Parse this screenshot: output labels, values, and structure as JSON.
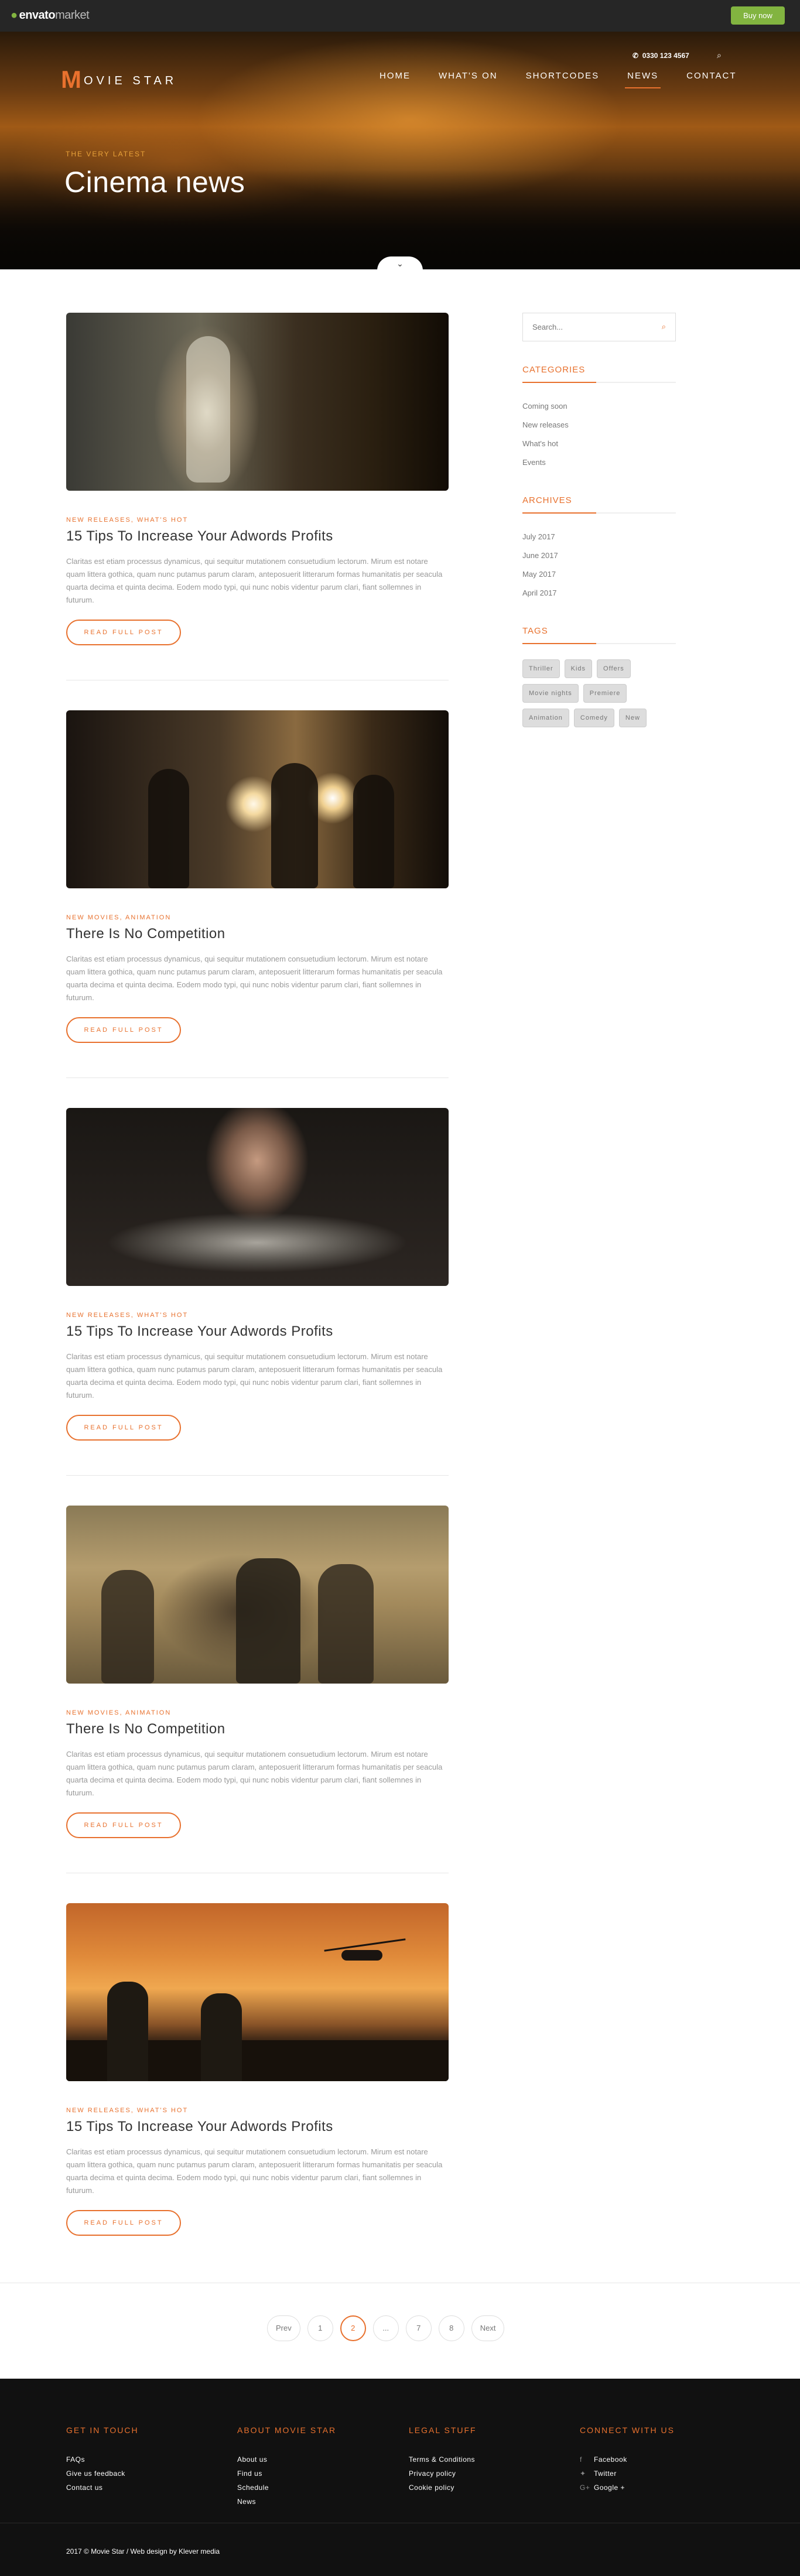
{
  "envato": {
    "logo_main": "envato",
    "logo_sub": "market",
    "buy_label": "Buy now"
  },
  "header": {
    "logo_letter": "M",
    "logo_text": "OVIE STAR",
    "phone": "0330 123 4567",
    "nav": [
      "HOME",
      "WHAT'S ON",
      "SHORTCODES",
      "NEWS",
      "CONTACT"
    ],
    "active_nav": "NEWS"
  },
  "hero": {
    "kicker": "THE VERY LATEST",
    "title": "Cinema news"
  },
  "posts": [
    {
      "categories": "NEW RELEASES, WHAT'S HOT",
      "title": "15 Tips To Increase Your Adwords Profits",
      "excerpt": "Claritas est etiam processus dynamicus, qui sequitur mutationem consuetudium lectorum. Mirum est notare quam littera gothica, quam nunc putamus parum claram, anteposuerit litterarum formas humanitatis per seacula quarta decima et quinta decima. Eodem modo typi, qui nunc nobis videntur parum clari, fiant sollemnes in futurum.",
      "button": "READ FULL POST"
    },
    {
      "categories": "NEW MOVIES, ANIMATION",
      "title": "There Is No Competition",
      "excerpt": "Claritas est etiam processus dynamicus, qui sequitur mutationem consuetudium lectorum. Mirum est notare quam littera gothica, quam nunc putamus parum claram, anteposuerit litterarum formas humanitatis per seacula quarta decima et quinta decima. Eodem modo typi, qui nunc nobis videntur parum clari, fiant sollemnes in futurum.",
      "button": "READ FULL POST"
    },
    {
      "categories": "NEW RELEASES, WHAT'S HOT",
      "title": "15 Tips To Increase Your Adwords Profits",
      "excerpt": "Claritas est etiam processus dynamicus, qui sequitur mutationem consuetudium lectorum. Mirum est notare quam littera gothica, quam nunc putamus parum claram, anteposuerit litterarum formas humanitatis per seacula quarta decima et quinta decima. Eodem modo typi, qui nunc nobis videntur parum clari, fiant sollemnes in futurum.",
      "button": "READ FULL POST"
    },
    {
      "categories": "NEW MOVIES, ANIMATION",
      "title": "There Is No Competition",
      "excerpt": "Claritas est etiam processus dynamicus, qui sequitur mutationem consuetudium lectorum. Mirum est notare quam littera gothica, quam nunc putamus parum claram, anteposuerit litterarum formas humanitatis per seacula quarta decima et quinta decima. Eodem modo typi, qui nunc nobis videntur parum clari, fiant sollemnes in futurum.",
      "button": "READ FULL POST"
    },
    {
      "categories": "NEW RELEASES, WHAT'S HOT",
      "title": "15 Tips To Increase Your Adwords Profits",
      "excerpt": "Claritas est etiam processus dynamicus, qui sequitur mutationem consuetudium lectorum. Mirum est notare quam littera gothica, quam nunc putamus parum claram, anteposuerit litterarum formas humanitatis per seacula quarta decima et quinta decima. Eodem modo typi, qui nunc nobis videntur parum clari, fiant sollemnes in futurum.",
      "button": "READ FULL POST"
    }
  ],
  "sidebar": {
    "search_placeholder": "Search...",
    "categories_title": "CATEGORIES",
    "categories": [
      "Coming soon",
      "New releases",
      "What's hot",
      "Events"
    ],
    "archives_title": "ARCHIVES",
    "archives": [
      "July 2017",
      "June 2017",
      "May 2017",
      "April 2017"
    ],
    "tags_title": "TAGS",
    "tags": [
      "Thriller",
      "Kids",
      "Offers",
      "Movie nights",
      "Premiere",
      "Animation",
      "Comedy",
      "New"
    ]
  },
  "pagination": {
    "items": [
      "Prev",
      "1",
      "2",
      "...",
      "7",
      "8",
      "Next"
    ],
    "active": "2"
  },
  "footer": {
    "col1": {
      "title": "GET IN TOUCH",
      "links": [
        "FAQs",
        "Give us feedback",
        "Contact us"
      ]
    },
    "col2": {
      "title": "ABOUT MOVIE STAR",
      "links": [
        "About us",
        "Find us",
        "Schedule",
        "News"
      ]
    },
    "col3": {
      "title": "LEGAL STUFF",
      "links": [
        "Terms & Conditions",
        "Privacy policy",
        "Cookie policy"
      ]
    },
    "col4": {
      "title": "CONNECT WITH US",
      "links": [
        "Facebook",
        "Twitter",
        "Google +"
      ]
    },
    "copyright": "2017 © Movie Star / Web design by Klever media"
  },
  "colors": {
    "accent": "#e8712e",
    "envato_green": "#82b440",
    "footer_bg": "#111111"
  }
}
